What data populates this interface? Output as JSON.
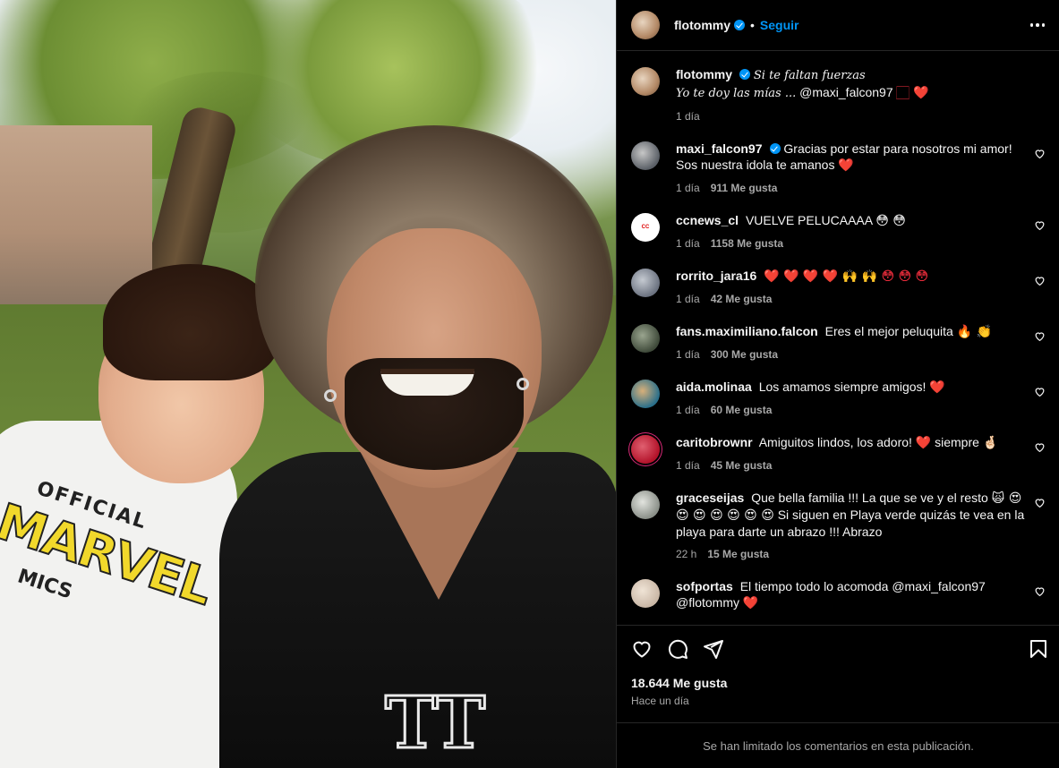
{
  "post": {
    "author": "flotommy",
    "follow_label": "Seguir",
    "caption_line1": "Si te faltan fuerzas",
    "caption_line2": "Yo te doy las mías ...",
    "caption_mention": "@maxi_falcon97",
    "caption_emojis": "🏻 ❤️",
    "caption_time": "1 día"
  },
  "image": {
    "shirt_top": "OFFICIAL",
    "shirt_brand": "MARVEL",
    "shirt_bottom": "MICS",
    "tshirt_logo": "TT"
  },
  "comments": [
    {
      "user": "maxi_falcon97",
      "verified": true,
      "text": "Gracias por estar para nosotros mi amor! Sos nuestra idola te amanos",
      "emoji": "❤️",
      "time": "1 día",
      "likes": "911 Me gusta",
      "avatar_color": "#5a5f66"
    },
    {
      "user": "ccnews_cl",
      "verified": false,
      "text": "VUELVE PELUCAAAA",
      "emoji": "😳 😳",
      "time": "1 día",
      "likes": "1158 Me gusta",
      "avatar_color": "#ffffff"
    },
    {
      "user": "rorrito_jara16",
      "verified": false,
      "text": "",
      "emoji": "❤️ ❤️ ❤️ ❤️ 🙌 🙌 😳 😳 😳",
      "time": "1 día",
      "likes": "42 Me gusta",
      "avatar_color": "#6b7280"
    },
    {
      "user": "fans.maximiliano.falcon",
      "verified": false,
      "text": "Eres el mejor peluquita",
      "emoji": "🔥 👏",
      "time": "1 día",
      "likes": "300 Me gusta",
      "avatar_color": "#3f4a3a"
    },
    {
      "user": "aida.molinaa",
      "verified": false,
      "text": "Los amamos siempre amigos!",
      "emoji": "❤️",
      "time": "1 día",
      "likes": "60 Me gusta",
      "avatar_color": "#2a6f8a"
    },
    {
      "user": "caritobrownr",
      "verified": false,
      "text": "Amiguitos lindos, los adoro!",
      "emoji": "❤️",
      "text2": "siempre",
      "emoji2": "🤞🏻",
      "time": "1 día",
      "likes": "45 Me gusta",
      "avatar_color": "#b3122a"
    },
    {
      "user": "graceseijas",
      "verified": false,
      "text": "Que bella familia !!! La que se ve y el resto",
      "emoji": "🙀 😍 😍 😍 😍 😍 😍 😍",
      "text2": "Si siguen en Playa verde quizás te vea en la playa para darte un abrazo !!! Abrazo",
      "time": "22 h",
      "likes": "15 Me gusta",
      "avatar_color": "#8a8f88"
    },
    {
      "user": "sofportas",
      "verified": false,
      "text": "El tiempo todo lo acomoda @maxi_falcon97 @flotommy",
      "emoji": "❤️",
      "time": "",
      "likes": "",
      "avatar_color": "#c9b7a6"
    }
  ],
  "actions": {
    "likes": "18.644 Me gusta",
    "time": "Hace un día",
    "limited_notice": "Se han limitado los comentarios en esta publicación."
  },
  "icons": [
    "heart-icon",
    "comment-icon",
    "share-icon",
    "bookmark-icon",
    "more-icon",
    "verified-icon"
  ],
  "colors": {
    "accent": "#0095f6",
    "background": "#000000",
    "muted": "#a8a8a8",
    "like_red": "#ff3040"
  }
}
